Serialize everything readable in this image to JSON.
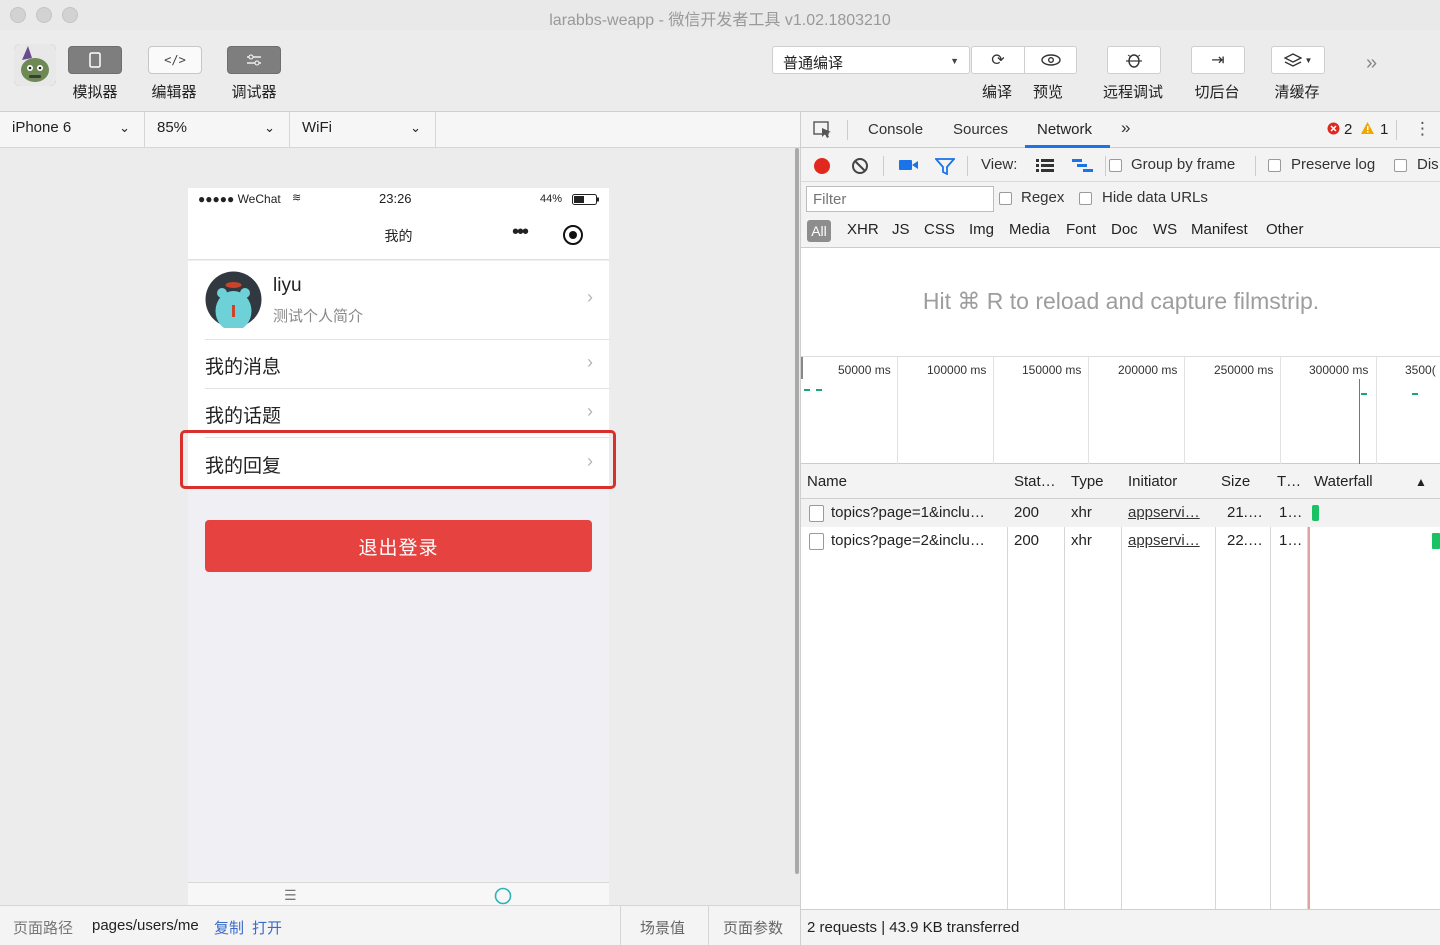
{
  "window": {
    "title": "larabbs-weapp - 微信开发者工具 v1.02.1803210"
  },
  "toolbar": {
    "simulator": "模拟器",
    "editor": "编辑器",
    "debugger": "调试器",
    "compile_mode": "普通编译",
    "compile": "编译",
    "preview": "预览",
    "remote_debug": "远程调试",
    "background": "切后台",
    "clear_cache": "清缓存"
  },
  "device": {
    "model": "iPhone 6",
    "zoom": "85%",
    "network": "WiFi"
  },
  "phone": {
    "signal": "●●●●● WeChat",
    "time": "23:26",
    "battery": "44%",
    "nav_title": "我的",
    "user": {
      "name": "liyu",
      "intro": "测试个人简介"
    },
    "menu": [
      "我的消息",
      "我的话题",
      "我的回复"
    ],
    "logout": "退出登录"
  },
  "bottombar": {
    "path_label": "页面路径",
    "path": "pages/users/me",
    "copy": "复制",
    "open": "打开",
    "scene": "场景值",
    "params": "页面参数"
  },
  "devtools": {
    "tabs": [
      "Console",
      "Sources",
      "Network"
    ],
    "active_tab": "Network",
    "errors": "2",
    "warnings": "1",
    "view_label": "View:",
    "group_by_frame": "Group by frame",
    "preserve_log": "Preserve log",
    "disable_cache": "Dis",
    "filter_placeholder": "Filter",
    "regex": "Regex",
    "hide_data_urls": "Hide data URLs",
    "types": [
      "All",
      "XHR",
      "JS",
      "CSS",
      "Img",
      "Media",
      "Font",
      "Doc",
      "WS",
      "Manifest",
      "Other"
    ],
    "filmstrip_msg": "Hit ⌘ R to reload and capture filmstrip.",
    "overview_ticks": [
      "50000 ms",
      "100000 ms",
      "150000 ms",
      "200000 ms",
      "250000 ms",
      "300000 ms",
      "3500("
    ],
    "columns": {
      "name": "Name",
      "status": "Stat…",
      "type": "Type",
      "initiator": "Initiator",
      "size": "Size",
      "time": "T…",
      "waterfall": "Waterfall"
    },
    "rows": [
      {
        "name": "topics?page=1&inclu…",
        "status": "200",
        "type": "xhr",
        "initiator": "appservi…",
        "size": "21.…",
        "time": "1…",
        "waterfall_start": 0.02
      },
      {
        "name": "topics?page=2&inclu…",
        "status": "200",
        "type": "xhr",
        "initiator": "appservi…",
        "size": "22.…",
        "time": "1…",
        "waterfall_start": 0.96
      }
    ],
    "footer": "2 requests | 43.9 KB transferred"
  },
  "colors": {
    "accent_red": "#e64340",
    "highlight": "#d9302c",
    "record": "#e0281f",
    "network_blue": "#1a73e8"
  }
}
